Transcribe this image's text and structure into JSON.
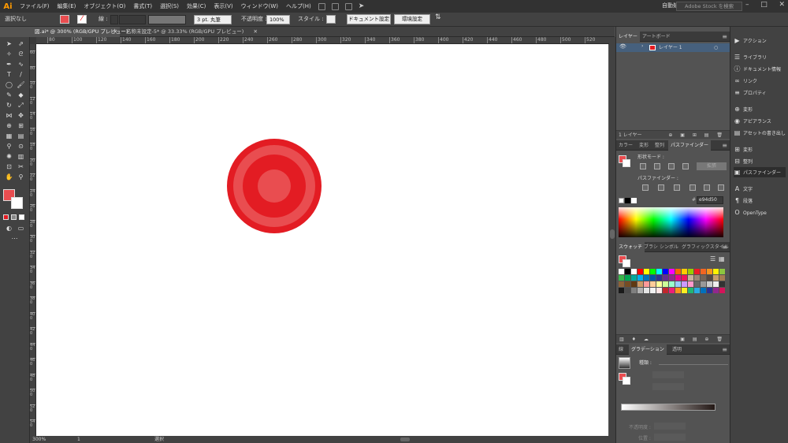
{
  "app": {
    "logo": "Ai"
  },
  "menu": [
    "ファイル(F)",
    "編集(E)",
    "オブジェクト(O)",
    "書式(T)",
    "選択(S)",
    "効果(C)",
    "表示(V)",
    "ウィンドウ(W)",
    "ヘルプ(H)"
  ],
  "workspace": {
    "label": "自動処理 ▾"
  },
  "search": {
    "placeholder": "Adobe Stock を検索"
  },
  "control": {
    "selection_label": "選択なし",
    "stroke_label": "線 :",
    "stroke_profile": "3 pt. 丸筆",
    "opacity_label": "不透明度 :",
    "opacity_value": "100%",
    "style_label": "スタイル :",
    "doc_setup": "ドキュメント設定",
    "preferences": "環境設定"
  },
  "tabs": [
    {
      "label": "図.ai* @ 300% (RGB/GPU プレビュー)"
    },
    {
      "label": "名称未設定-5* @ 33.33% (RGB/GPU プレビュー)"
    }
  ],
  "ruler": {
    "h": [
      "80",
      "100",
      "120",
      "140",
      "160",
      "180",
      "200",
      "220",
      "240",
      "260",
      "280",
      "300",
      "320",
      "340",
      "360",
      "380",
      "400",
      "420",
      "440",
      "460",
      "480",
      "500",
      "520"
    ],
    "v": [
      "60",
      "80",
      "100",
      "120",
      "140",
      "160",
      "180",
      "200",
      "220",
      "240",
      "260",
      "280",
      "300",
      "320",
      "340",
      "360",
      "380",
      "400",
      "420",
      "440",
      "460",
      "480",
      "500",
      "520",
      "540"
    ]
  },
  "status": {
    "zoom": "300%",
    "page": "1",
    "mode": "選択"
  },
  "artwork": {
    "outer_color": "#e31c23",
    "ring_color": "#e94d50",
    "inner_color": "#e31c23",
    "center_color": "#e94d50"
  },
  "layers": {
    "tabs": [
      "レイヤー",
      "アートボード"
    ],
    "items": [
      {
        "name": "レイヤー 1"
      }
    ],
    "footer": "1 レイヤー"
  },
  "color_panel": {
    "tabs": [
      "カラー",
      "変形",
      "整列",
      "パスファインダー"
    ],
    "shape_modes_label": "形状モード :",
    "expand_label": "拡張",
    "pathfinder_label": "パスファインダー :",
    "hex_value": "e94d50"
  },
  "swatches": {
    "tabs": [
      "スウォッチ",
      "ブラシ",
      "シンボル",
      "グラフィックスタイル"
    ],
    "colors": [
      "#ffffff",
      "#000000",
      "#ffffff",
      "#ff0000",
      "#ffff00",
      "#00ff00",
      "#00ffff",
      "#0000ff",
      "#ff00ff",
      "#ff6600",
      "#ffcc00",
      "#99cc00",
      "#ed1c24",
      "#f26522",
      "#f7941d",
      "#fff200",
      "#8dc63f",
      "#39b54a",
      "#00a651",
      "#00a99d",
      "#00aeef",
      "#0072bc",
      "#0054a6",
      "#2e3192",
      "#662d91",
      "#92278f",
      "#ec008c",
      "#ed145b",
      "#c7b299",
      "#998675",
      "#736357",
      "#534741",
      "#c69c6d",
      "#a67c52",
      "#8c6239",
      "#754c24",
      "#603913",
      "#cc9966",
      "#ff9999",
      "#ffcc99",
      "#ffff99",
      "#ccff99",
      "#99ffcc",
      "#99ccff",
      "#cc99ff",
      "#ff99cc",
      "#666666",
      "#999999",
      "#cccccc",
      "#eeeeee",
      "#333333",
      "#1a1a1a",
      "#4d4d4d",
      "#808080",
      "#b3b3b3",
      "#e6e6e6",
      "#f2f2f2",
      "#ffe6e6",
      "#c1272d",
      "#ed1e79",
      "#f7931e",
      "#fcee21",
      "#22b573",
      "#29abe2",
      "#0071bc",
      "#2e3192",
      "#93278f",
      "#d4145a"
    ]
  },
  "gradient_panel": {
    "tabs": [
      "線",
      "グラデーション",
      "透明"
    ],
    "type_label": "種類 :",
    "opacity_label": "不透明度 :",
    "location_label": "位置 :"
  },
  "dock": [
    {
      "icon": "▶",
      "label": "アクション"
    },
    {
      "icon": "☰",
      "label": "ライブラリ"
    },
    {
      "icon": "ⓘ",
      "label": "ドキュメント情報"
    },
    {
      "icon": "∞",
      "label": "リンク"
    },
    {
      "icon": "≡",
      "label": "プロパティ"
    },
    {
      "icon": "⊕",
      "label": "変形"
    },
    {
      "icon": "◉",
      "label": "アピアランス"
    },
    {
      "icon": "▤",
      "label": "アセットの書き出し"
    },
    {
      "icon": "⊞",
      "label": "変形"
    },
    {
      "icon": "⊟",
      "label": "整列"
    },
    {
      "icon": "▣",
      "label": "パスファインダー"
    },
    {
      "icon": "A",
      "label": "文字"
    },
    {
      "icon": "¶",
      "label": "段落"
    },
    {
      "icon": "O",
      "label": "OpenType"
    }
  ]
}
